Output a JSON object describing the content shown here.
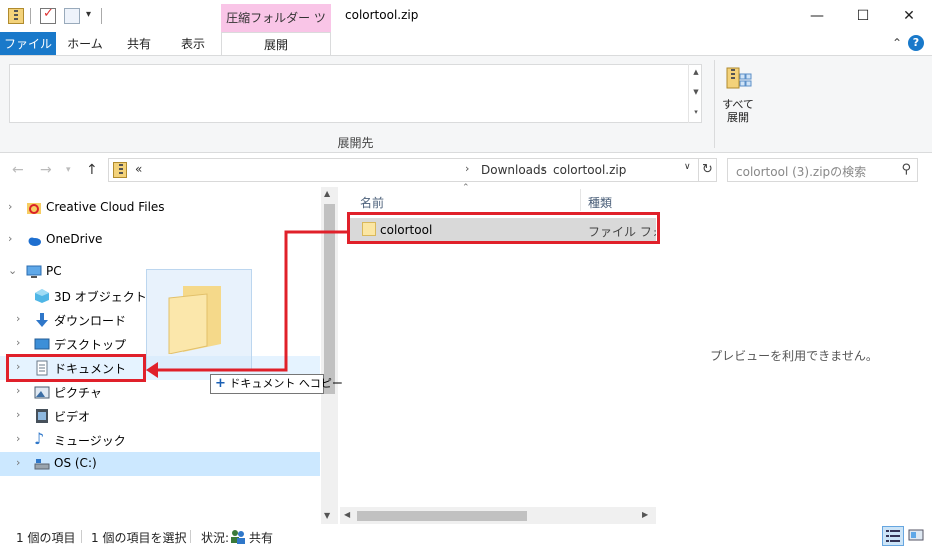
{
  "window": {
    "title": "colortool.zip",
    "context_tab_group": "圧縮フォルダー ツール",
    "minimize": "—",
    "maximize": "☐",
    "close": "✕"
  },
  "ribbon": {
    "tabs": [
      {
        "label": "ファイル"
      },
      {
        "label": "ホーム"
      },
      {
        "label": "共有"
      },
      {
        "label": "表示"
      },
      {
        "label": "展開"
      }
    ],
    "destination_group_label": "展開先",
    "extract_all_label": "すべて\n展開"
  },
  "address": {
    "overflow": "«",
    "crumbs": [
      "Downloads",
      "colortool.zip"
    ],
    "search_placeholder": "colortool (3).zipの検索"
  },
  "navpane": {
    "items": [
      {
        "label": "Creative Cloud Files"
      },
      {
        "label": "OneDrive"
      },
      {
        "label": "PC"
      },
      {
        "label": "3D オブジェクト"
      },
      {
        "label": "ダウンロード"
      },
      {
        "label": "デスクトップ"
      },
      {
        "label": "ドキュメント"
      },
      {
        "label": "ピクチャ"
      },
      {
        "label": "ビデオ"
      },
      {
        "label": "ミュージック"
      },
      {
        "label": "OS (C:)"
      }
    ]
  },
  "content": {
    "columns": {
      "name": "名前",
      "type": "種類"
    },
    "rows": [
      {
        "name": "colortool",
        "type": "ファイル フォルダー"
      }
    ]
  },
  "preview": {
    "message": "プレビューを利用できません。"
  },
  "drag": {
    "tooltip": "ドキュメント へコピー",
    "plus": "+"
  },
  "status": {
    "item_count": "1 個の項目",
    "selected": "1 個の項目を選択",
    "state_label": "状況:",
    "state_value": "共有"
  },
  "colors": {
    "accent": "#1979ca",
    "context_tab": "#f9c5e7",
    "annotation": "#e0202a",
    "selection": "#cce8ff"
  }
}
